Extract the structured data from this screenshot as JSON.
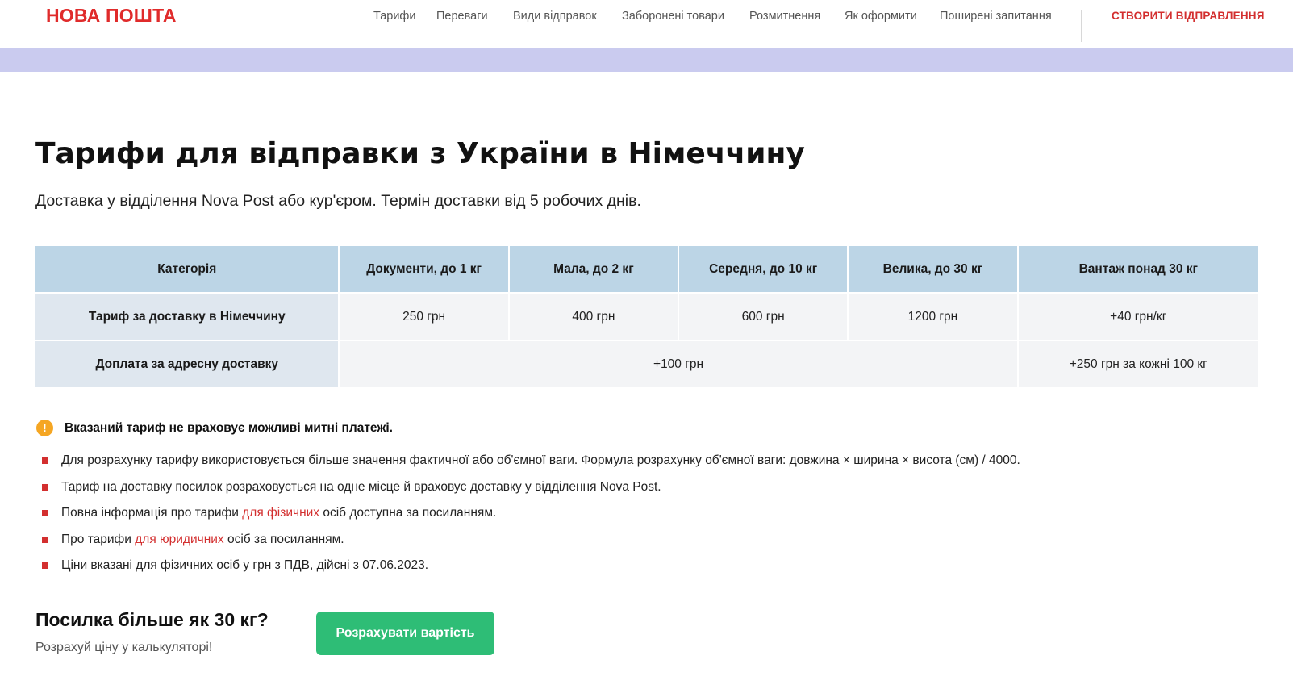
{
  "header": {
    "logo": "НОВА ПОШТА",
    "nav": [
      {
        "label": "Тарифи"
      },
      {
        "label": "Переваги"
      },
      {
        "label": "Види відправок"
      },
      {
        "label": "Заборонені товари"
      },
      {
        "label": "Розмитнення"
      },
      {
        "label": "Як оформити"
      },
      {
        "label": "Поширені запитання"
      }
    ],
    "cta": "СТВОРИТИ ВІДПРАВЛЕННЯ"
  },
  "page": {
    "title": "Тарифи для відправки з України в Німеччину",
    "subtitle": "Доставка у відділення Nova Post або кур'єром. Термін доставки від 5 робочих днів."
  },
  "table": {
    "headers": [
      "Категорія",
      "Документи, до 1 кг",
      "Мала, до 2 кг",
      "Середня, до 10 кг",
      "Велика, до 30 кг",
      "Вантаж понад 30 кг"
    ],
    "row1": {
      "label": "Тариф за доставку в Німеччину",
      "values": [
        "250 грн",
        "400 грн",
        "600 грн",
        "1200 грн",
        "+40 грн/кг"
      ]
    },
    "row2": {
      "label": "Доплата за адресну доставку",
      "values": [
        "+100 грн",
        "+250 грн за кожні 100 кг"
      ]
    }
  },
  "warning": {
    "icon": "exclamation-icon",
    "text": "Вказаний тариф не враховує можливі митні платежі."
  },
  "notes": {
    "n1": "Для розрахунку тарифу використовується більше значення фактичної або об'ємної ваги. Формула розрахунку об'ємної ваги: довжина × ширина × висота (см) / 4000.",
    "n2": "Тариф на доставку посилок розраховується на одне місце й враховує доставку у відділення Nova Post.",
    "n3_before": "Повна інформація про тарифи ",
    "n3_link": "для фізичних",
    "n3_after": " осіб доступна за посиланням.",
    "n4_before": "Про тарифи ",
    "n4_link": "для юридичних",
    "n4_after": " осіб за посиланням.",
    "n5": "Ціни вказані для фізичних осіб у грн з ПДВ, дійсні з 07.06.2023."
  },
  "promo": {
    "title": "Посилка більше як 30 кг?",
    "subtitle": "Розрахуй ціну у калькуляторі!",
    "button": "Розрахувати вартість"
  },
  "colors": {
    "brand_red": "#e02b2b",
    "band": "#cacbef",
    "table_header": "#bcd5e6",
    "button_green": "#2ebd76",
    "warning_orange": "#f5a623"
  }
}
